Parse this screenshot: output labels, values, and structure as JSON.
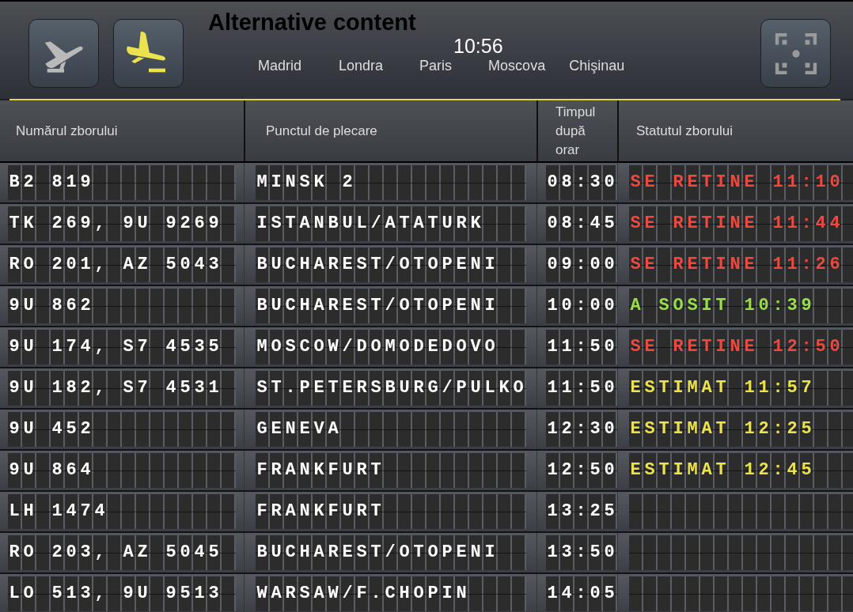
{
  "header": {
    "mode_buttons": [
      {
        "kind": "departures",
        "selected": false
      },
      {
        "kind": "arrivals",
        "selected": true
      }
    ],
    "title": "Alternative content",
    "clock": "10:56",
    "cities": [
      "Madrid",
      "Londra",
      "Paris",
      "Moscova",
      "Chişinau"
    ]
  },
  "table": {
    "columns": [
      "Numărul zborului",
      "Punctul de plecare",
      "Timpul după orar",
      "Statutul zborului"
    ],
    "rows": [
      {
        "flight": "B2 819",
        "origin": "MINSK 2",
        "scheduled": "08:30",
        "status": {
          "kind": "delayed",
          "text": "SE RETINE 11:10"
        }
      },
      {
        "flight": "TK 269, 9U 9269",
        "origin": "ISTANBUL/ATATURK",
        "scheduled": "08:45",
        "status": {
          "kind": "delayed",
          "text": "SE RETINE 11:44"
        }
      },
      {
        "flight": "RO 201, AZ 5043",
        "origin": "BUCHAREST/OTOPENI",
        "scheduled": "09:00",
        "status": {
          "kind": "delayed",
          "text": "SE RETINE 11:26"
        }
      },
      {
        "flight": "9U 862",
        "origin": "BUCHAREST/OTOPENI",
        "scheduled": "10:00",
        "status": {
          "kind": "arrived",
          "text": "A SOSIT 10:39"
        }
      },
      {
        "flight": "9U 174, S7 4535",
        "origin": "MOSCOW/DOMODEDOVO",
        "scheduled": "11:50",
        "status": {
          "kind": "delayed",
          "text": "SE RETINE 12:50"
        }
      },
      {
        "flight": "9U 182, S7 4531",
        "origin": "ST.PETERSBURG/PULKO",
        "scheduled": "11:50",
        "status": {
          "kind": "estimated",
          "text": "ESTIMAT 11:57"
        }
      },
      {
        "flight": "9U 452",
        "origin": "GENEVA",
        "scheduled": "12:30",
        "status": {
          "kind": "estimated",
          "text": "ESTIMAT 12:25"
        }
      },
      {
        "flight": "9U 864",
        "origin": "FRANKFURT",
        "scheduled": "12:50",
        "status": {
          "kind": "estimated",
          "text": "ESTIMAT 12:45"
        }
      },
      {
        "flight": "LH 1474",
        "origin": "FRANKFURT",
        "scheduled": "13:25"
      },
      {
        "flight": "RO 203, AZ 5045",
        "origin": "BUCHAREST/OTOPENI",
        "scheduled": "13:50"
      },
      {
        "flight": "LO 513, 9U 9513",
        "origin": "WARSAW/F.CHOPIN",
        "scheduled": "14:05"
      }
    ]
  }
}
